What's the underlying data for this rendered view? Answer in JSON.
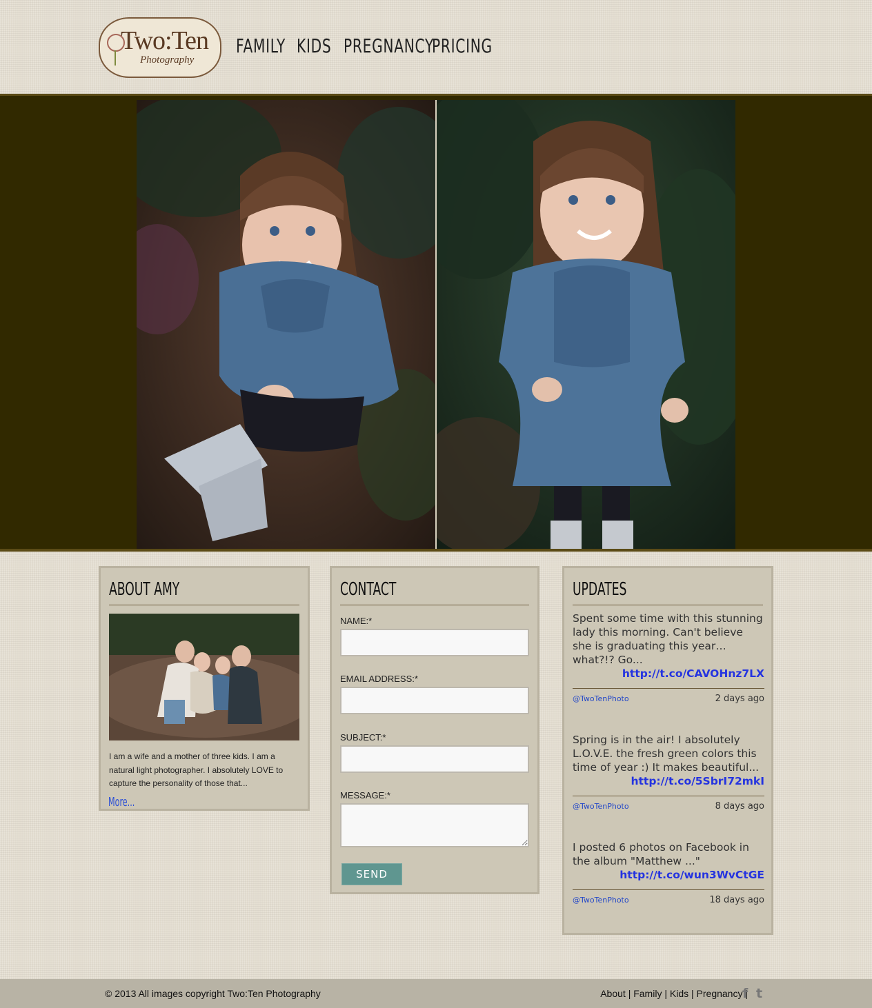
{
  "logo": {
    "line1": "Two:Ten",
    "line2": "Photography"
  },
  "nav": [
    {
      "label": "FAMILY"
    },
    {
      "label": "KIDS"
    },
    {
      "label": "PREGNANCY"
    },
    {
      "label": "PRICING"
    }
  ],
  "about": {
    "title": "ABOUT AMY",
    "text": "I am a wife and a mother of three kids. I am a natural light photographer. I absolutely LOVE to capture the personality of those that...",
    "more": "More..."
  },
  "contact": {
    "title": "CONTACT",
    "name_label": "NAME:*",
    "email_label": "EMAIL ADDRESS:*",
    "subject_label": "SUBJECT:*",
    "message_label": "MESSAGE:*",
    "send_label": "SEND"
  },
  "updates": {
    "title": "UPDATES",
    "tweets": [
      {
        "text": "Spent some time with this stunning lady this morning. Can't believe she is graduating this year…what?!? Go...",
        "link": "http://t.co/CAVOHnz7LX",
        "handle": "@TwoTenPhoto",
        "ago": "2 days ago"
      },
      {
        "text": "Spring is in the air! I absolutely L.O.V.E. the fresh green colors this time of year :) It makes beautiful...",
        "link": "http://t.co/5SbrI72mkI",
        "handle": "@TwoTenPhoto",
        "ago": "8 days ago"
      },
      {
        "text": "I posted 6 photos on Facebook in the album \"Matthew ...\"",
        "link": "http://t.co/wun3WvCtGE",
        "handle": "@TwoTenPhoto",
        "ago": "18 days ago"
      }
    ]
  },
  "footer": {
    "copyright": "© 2013 All images copyright Two:Ten Photography",
    "links": [
      {
        "label": "About"
      },
      {
        "label": "Family"
      },
      {
        "label": "Kids"
      },
      {
        "label": "Pregnancy"
      }
    ],
    "icons": [
      "facebook-icon",
      "twitter-icon"
    ]
  },
  "colors": {
    "hero_bg": "#312900",
    "panel_bg": "#cdc7b6",
    "send_button": "#5f9690",
    "link": "#2433e0"
  }
}
